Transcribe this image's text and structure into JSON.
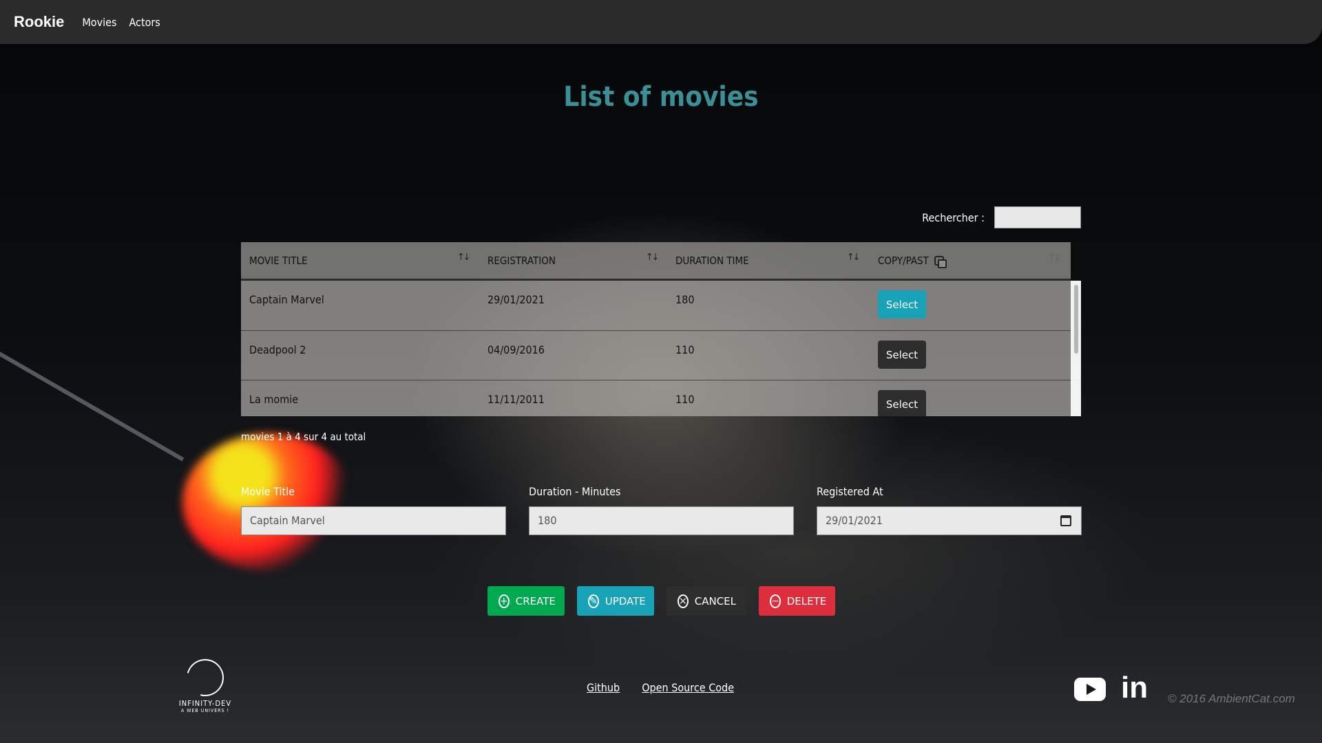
{
  "navbar": {
    "brand": "Rookie",
    "links": [
      "Movies",
      "Actors"
    ]
  },
  "page_title": "List of movies",
  "search": {
    "label": "Rechercher :",
    "value": ""
  },
  "table": {
    "columns": [
      "MOVIE TITLE",
      "REGISTRATION",
      "DURATION TIME",
      "COPY/PAST"
    ],
    "sort_icon": "sort-arrows-icon",
    "rows": [
      {
        "title": "Captain Marvel",
        "registration": "29/01/2021",
        "duration": "180",
        "action": "Select",
        "selected": true
      },
      {
        "title": "Deadpool 2",
        "registration": "04/09/2016",
        "duration": "110",
        "action": "Select",
        "selected": false
      },
      {
        "title": "La momie",
        "registration": "11/11/2011",
        "duration": "110",
        "action": "Select",
        "selected": false
      }
    ],
    "info": "movies 1 à 4 sur 4 au total"
  },
  "form": {
    "title_label": "Movie Title",
    "title_value": "Captain Marvel",
    "duration_label": "Duration - Minutes",
    "duration_value": "180",
    "registered_label": "Registered At",
    "registered_value": "29/01/2021"
  },
  "actions": {
    "create": "CREATE",
    "update": "UPDATE",
    "cancel": "CANCEL",
    "delete": "DELETE"
  },
  "colors": {
    "title": "#3b8f96",
    "create": "#00a84f",
    "update": "#17a2b8",
    "cancel": "#2d2d2d",
    "delete": "#dc2e3d",
    "select_active": "#17a2b8"
  },
  "footer": {
    "logo_name": "INFINITY-DEV",
    "logo_tag": "A WEB UNIVERS !",
    "links": [
      "Github",
      "Open Source Code"
    ],
    "social_icons": [
      "youtube-icon",
      "linkedin-icon"
    ],
    "copyright": "© 2016 AmbientCat.com"
  }
}
